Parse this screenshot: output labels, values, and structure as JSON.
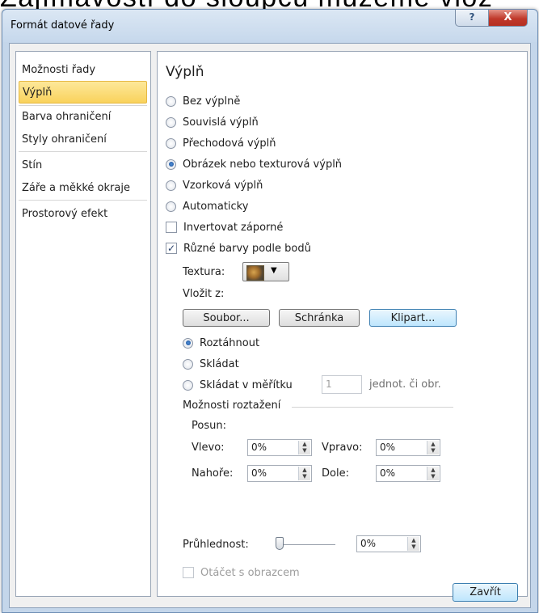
{
  "background_text": "Zajímavostí do sloupců můžeme vlož",
  "window": {
    "title": "Formát datové řady",
    "help_symbol": "?",
    "close_symbol": "X"
  },
  "nav": {
    "items": [
      {
        "label": "Možnosti řady",
        "selected": false
      },
      {
        "label": "Výplň",
        "selected": true
      },
      {
        "label": "Barva ohraničení",
        "selected": false
      },
      {
        "label": "Styly ohraničení",
        "selected": false
      },
      {
        "label": "Stín",
        "selected": false
      },
      {
        "label": "Záře a měkké okraje",
        "selected": false
      },
      {
        "label": "Prostorový efekt",
        "selected": false
      }
    ]
  },
  "panel": {
    "title": "Výplň",
    "fill_options": [
      {
        "label": "Bez výplně",
        "checked": false
      },
      {
        "label": "Souvislá výplň",
        "checked": false
      },
      {
        "label": "Přechodová výplň",
        "checked": false
      },
      {
        "label": "Obrázek nebo texturová výplň",
        "checked": true
      },
      {
        "label": "Vzorková výplň",
        "checked": false
      },
      {
        "label": "Automaticky",
        "checked": false
      }
    ],
    "invert_negative": {
      "label": "Invertovat záporné",
      "checked": false
    },
    "vary_colors": {
      "label": "Různé barvy podle bodů",
      "checked": true
    },
    "texture_label": "Textura:",
    "insert_from_label": "Vložit z:",
    "buttons": {
      "file": "Soubor...",
      "clipboard": "Schránka",
      "clipart": "Klipart..."
    },
    "tiling_options": [
      {
        "label": "Roztáhnout",
        "checked": true
      },
      {
        "label": "Skládat",
        "checked": false
      },
      {
        "label": "Skládat v měřítku",
        "checked": false
      }
    ],
    "scale_value": "1",
    "scale_unit": "jednot. či obr.",
    "stretch_options_title": "Možnosti roztažení",
    "offset_label": "Posun:",
    "offsets": {
      "left": {
        "label": "Vlevo:",
        "value": "0%"
      },
      "right": {
        "label": "Vpravo:",
        "value": "0%"
      },
      "top": {
        "label": "Nahoře:",
        "value": "0%"
      },
      "bottom": {
        "label": "Dole:",
        "value": "0%"
      }
    },
    "transparency": {
      "label": "Průhlednost:",
      "value": "0%",
      "level": 0
    },
    "rotate_with_shape": {
      "label": "Otáčet s obrazcem",
      "checked": false
    }
  },
  "footer": {
    "close_label": "Zavřít"
  },
  "icons": {
    "spin_up": "▲",
    "spin_down": "▼",
    "dropdown": "▼",
    "check": "✓"
  }
}
